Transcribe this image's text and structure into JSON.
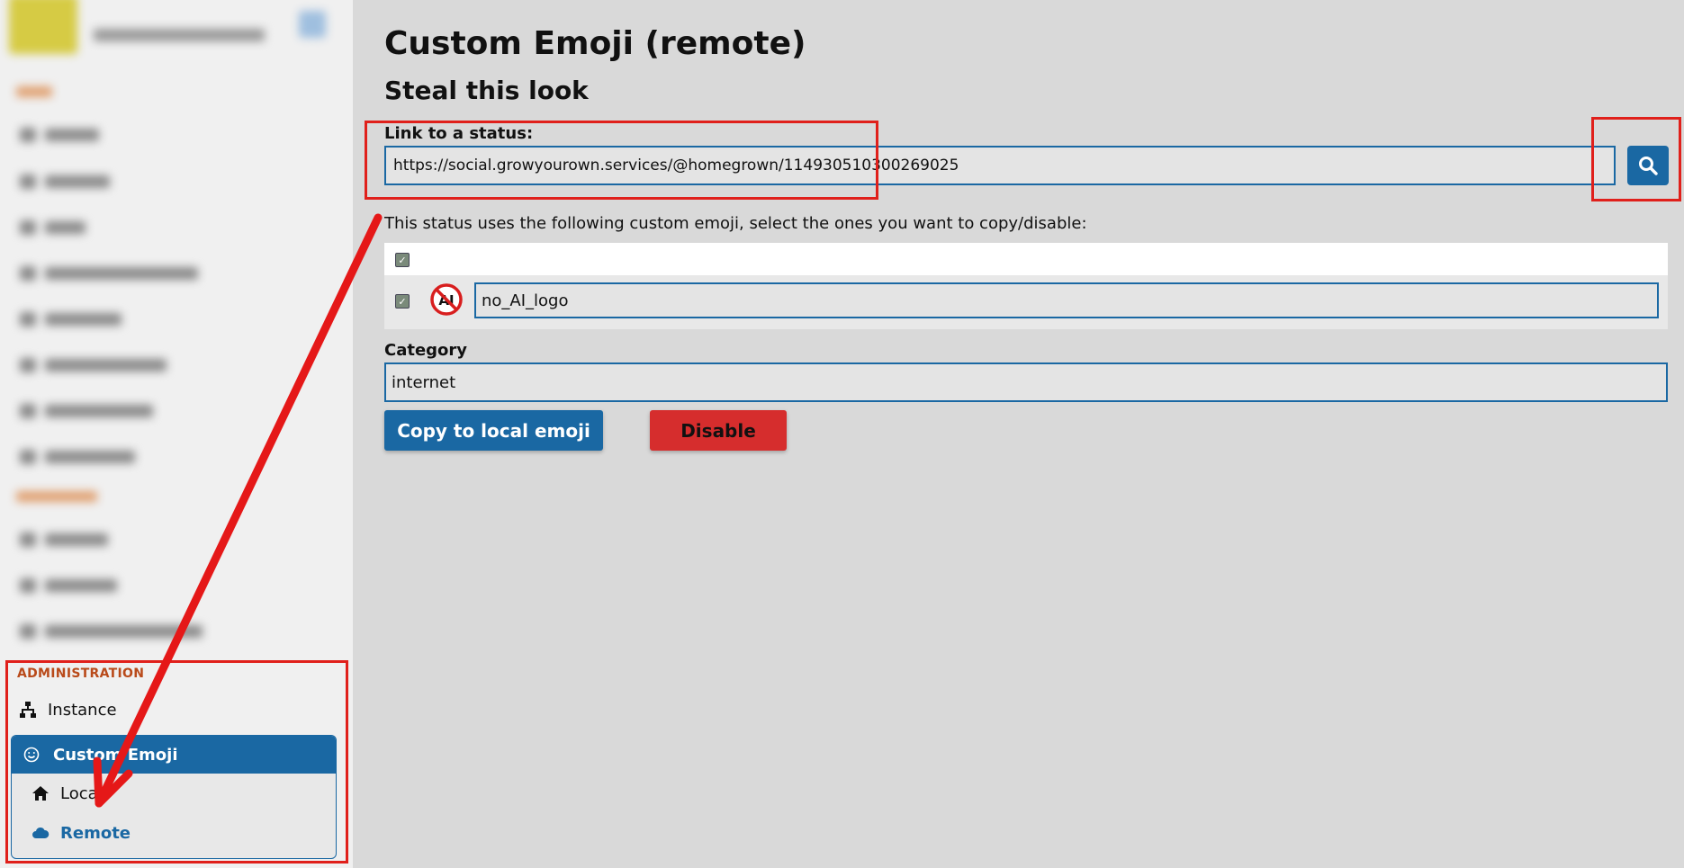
{
  "sidebar": {
    "admin_heading": "ADMINISTRATION",
    "instance_label": "Instance",
    "custom_emoji_label": "Custom Emoji",
    "local_label": "Local",
    "remote_label": "Remote"
  },
  "main": {
    "title": "Custom Emoji (remote)",
    "section_title": "Steal this look",
    "link_label": "Link to a status:",
    "link_value": "https://social.growyourown.services/@homegrown/114930510300269025",
    "status_note": "This status uses the following custom emoji, select the ones you want to copy/disable:",
    "emoji_shortcode": "no_AI_logo",
    "emoji_logo_text": "AI",
    "category_label": "Category",
    "category_value": "internet",
    "copy_button": "Copy to local emoji",
    "disable_button": "Disable"
  },
  "icons": {
    "instance": "sitemap-icon",
    "custom_emoji": "smiley-icon",
    "local": "home-icon",
    "remote": "cloud-icon",
    "search": "search-icon"
  },
  "colors": {
    "accent": "#1a68a3",
    "danger": "#d62d2d",
    "highlight": "#e0201b",
    "admin_heading": "#b94a1a"
  }
}
